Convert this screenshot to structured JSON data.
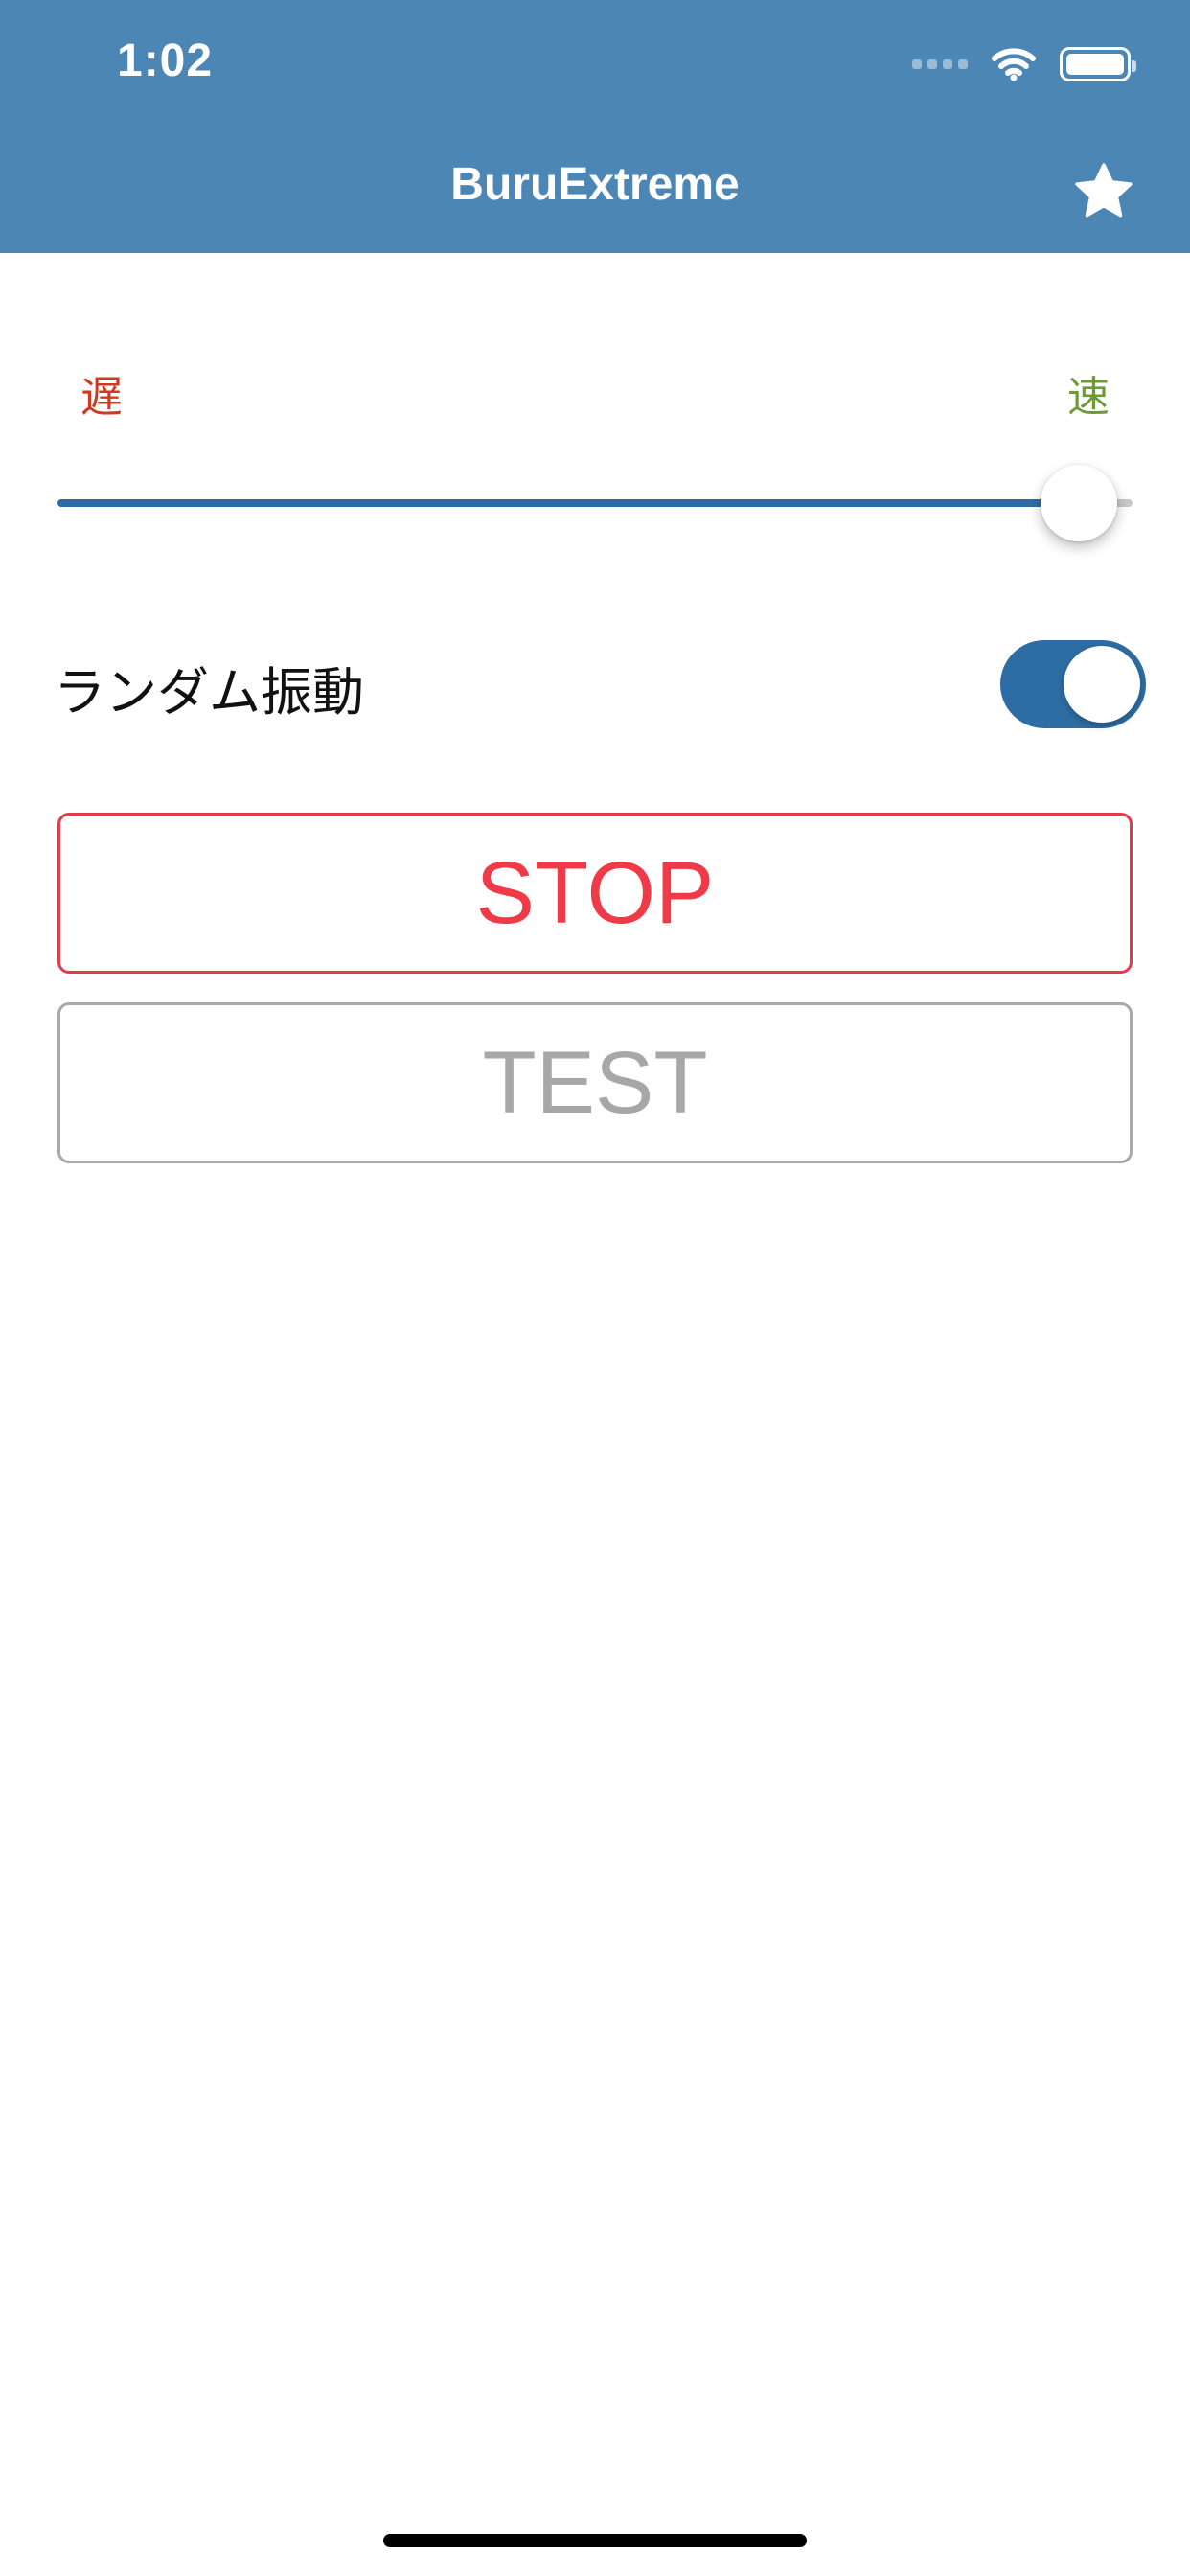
{
  "status_bar": {
    "time": "1:02"
  },
  "nav": {
    "title": "BuruExtreme",
    "favorite_icon": "star-icon"
  },
  "speed": {
    "slow_label": "遅",
    "fast_label": "速",
    "value": 0.95
  },
  "random_vibration": {
    "label": "ランダム振動",
    "enabled": true
  },
  "buttons": {
    "stop_label": "STOP",
    "test_label": "TEST"
  },
  "colors": {
    "header": "#4c86b4",
    "accent": "#2e6da4",
    "slow": "#d03822",
    "fast": "#6e9a36",
    "stop": "#f03a48",
    "test": "#a7a7a7"
  }
}
